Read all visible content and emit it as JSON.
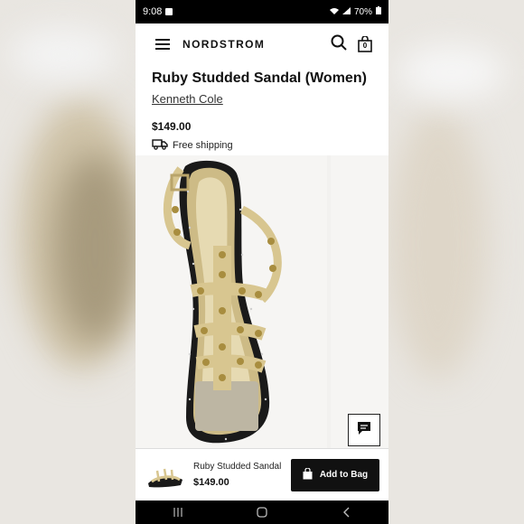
{
  "status_bar": {
    "time": "9:08",
    "battery": "70%"
  },
  "header": {
    "brand": "NORDSTROM",
    "bag_count": "0"
  },
  "product": {
    "title": "Ruby Studded Sandal (Women)",
    "brand": "Kenneth Cole",
    "price": "$149.00",
    "shipping": "Free shipping"
  },
  "sticky_bar": {
    "name": "Ruby Studded Sandal",
    "price": "$149.00",
    "add_to_bag": "Add to Bag"
  },
  "icons": {
    "menu": "menu-icon",
    "search": "search-icon",
    "bag": "shopping-bag-icon",
    "truck": "truck-icon",
    "chat": "chat-icon",
    "recents": "recents-icon",
    "home": "home-icon",
    "back": "back-icon"
  },
  "colors": {
    "accent": "#111111",
    "sandal_gold": "#d8c690",
    "sole": "#1a1a1a"
  }
}
